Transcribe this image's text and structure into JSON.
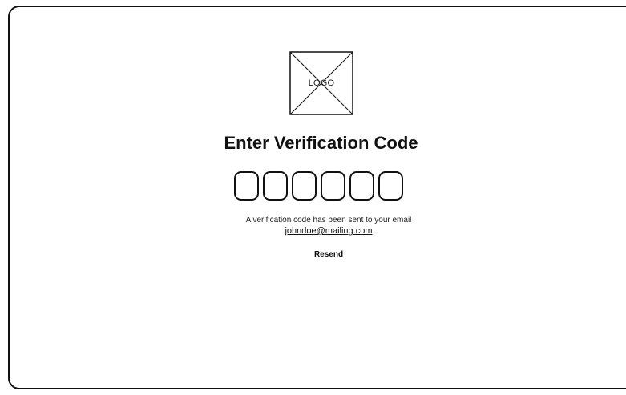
{
  "logo": {
    "label": "LOGO"
  },
  "title": "Enter Verification Code",
  "code_inputs": [
    "",
    "",
    "",
    "",
    "",
    ""
  ],
  "message": "A verification code has been sent to your email",
  "email": "johndoe@mailing.com",
  "resend_label": "Resend"
}
